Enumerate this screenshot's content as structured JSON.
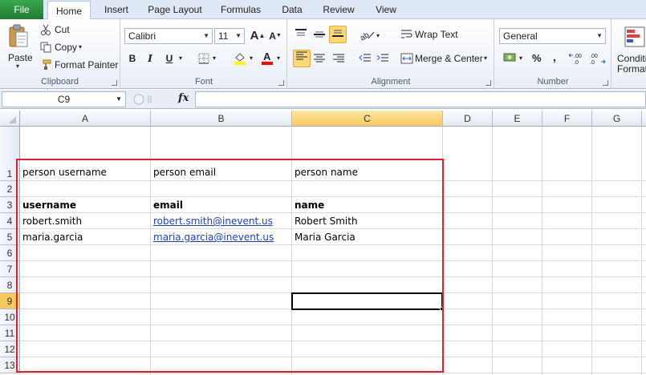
{
  "tabs": [
    "File",
    "Home",
    "Insert",
    "Page Layout",
    "Formulas",
    "Data",
    "Review",
    "View"
  ],
  "clipboard": {
    "paste": "Paste",
    "cut": "Cut",
    "copy": "Copy",
    "format_painter": "Format Painter",
    "label": "Clipboard"
  },
  "font": {
    "name": "Calibri",
    "size": "11",
    "label": "Font",
    "bold": "B",
    "italic": "I",
    "underline": "U"
  },
  "alignment": {
    "wrap_text": "Wrap Text",
    "merge_center": "Merge & Center",
    "label": "Alignment"
  },
  "number": {
    "format": "General",
    "label": "Number",
    "percent": "%",
    "comma": ",",
    "inc_decimal": ".00",
    "dec_decimal": ".00"
  },
  "styles": {
    "conditional_line1": "Conditi",
    "conditional_line2": "Formatt"
  },
  "formula_bar": {
    "name_box": "C9",
    "fx": "fx",
    "content": ""
  },
  "columns": [
    "A",
    "B",
    "C",
    "D",
    "E",
    "F",
    "G"
  ],
  "rows": [
    "1",
    "2",
    "3",
    "4",
    "5",
    "6",
    "7",
    "8",
    "9",
    "10",
    "11",
    "12",
    "13"
  ],
  "cells": {
    "a1": "person username",
    "b1": "person email",
    "c1": "person name",
    "a3": "username",
    "b3": "email",
    "c3": "name",
    "a4": "robert.smith",
    "b4": "robert.smith@inevent.us",
    "c4": "Robert Smith",
    "a5": "maria.garcia",
    "b5": "maria.garcia@inevent.us",
    "c5": "Maria Garcia"
  },
  "colors": {
    "selection_header": "#f9c95b",
    "highlight_box": "#e0202a",
    "link": "#1f3fb8",
    "file_tab": "#2b8a3e"
  }
}
